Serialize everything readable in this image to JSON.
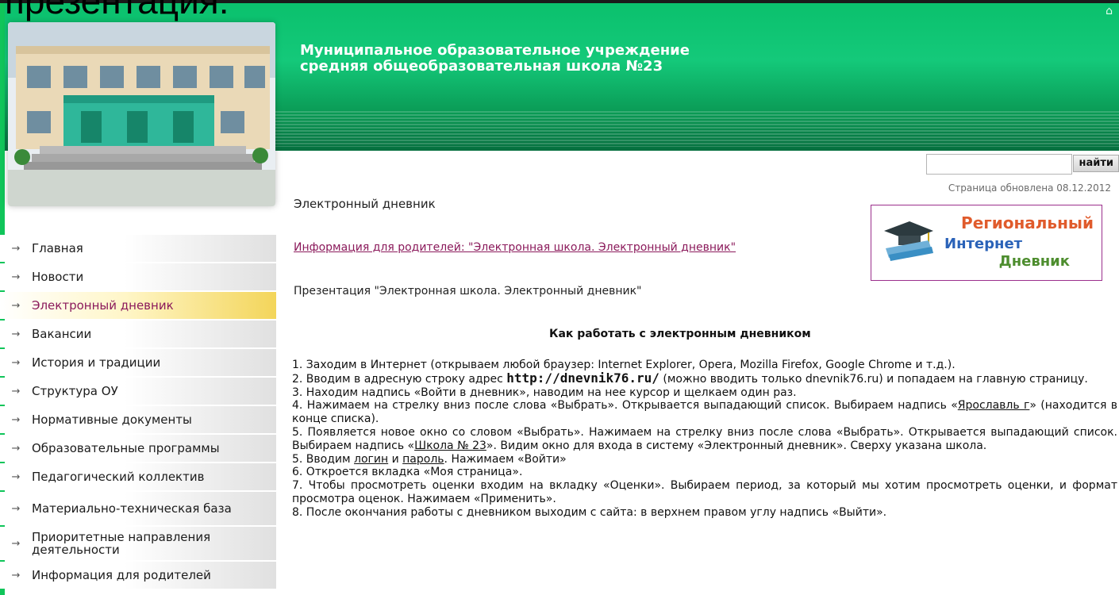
{
  "header": {
    "cut_text": "презентация:",
    "title_line1": "Муниципальное образовательное учреждение",
    "title_line2": "средняя общеобразовательная школа №23"
  },
  "search": {
    "button_label": "найти",
    "value": ""
  },
  "updated": "Страница обновлена 08.12.2012",
  "page_heading": "Электронный дневник",
  "info_link": "Информация для родителей: \"Электронная школа. Электронный дневник\"",
  "presentation": "Презентация \"Электронная школа. Электронный дневник\"",
  "how_title": "Как работать с электронным дневником",
  "banner": {
    "line1": "Региональный",
    "line2": "Интернет",
    "line3": "Дневник"
  },
  "nav": [
    "Главная",
    "Новости",
    "Электронный дневник",
    "Вакансии",
    "История и традиции",
    "Структура ОУ",
    "Нормативные документы",
    "Образовательные программы",
    "Педагогический коллектив",
    "Материально-техническая база",
    "Приоритетные направления деятельности",
    "Информация для родителей"
  ],
  "instructions": {
    "s1": "1. Заходим в Интернет (открываем любой браузер: Internet Explorer, Opera, Mozilla Firefox, Google Chrome и т.д.).",
    "s2a": "2. Вводим в адресную строку адрес ",
    "s2b": "http://dnevnik76.ru/",
    "s2c": " (можно вводить только dnevnik76.ru) и попадаем на главную страницу.",
    "s3": "3. Находим надпись «Войти в дневник», наводим на нее курсор и щелкаем один раз.",
    "s4a": "4. Нажимаем на стрелку вниз после слова «Выбрать». Открывается выпадающий список. Выбираем надпись «",
    "s4b": "Ярославль г",
    "s4c": "» (находится в конце списка).",
    "s5a": "5. Появляется новое окно со словом «Выбрать». Нажимаем на стрелку вниз после слова «Выбрать». Открывается выпадающий список. Выбираем надпись «",
    "s5b": "Школа № 23",
    "s5c": "». Видим окно для входа в систему «Электронный дневник». Сверху указана школа.",
    "s6a": "5. Вводим ",
    "s6b": "логин",
    "s6c": " и ",
    "s6d": "пароль",
    "s6e": ". Нажимаем «Войти»",
    "s7": "6. Откроется вкладка «Моя страница».",
    "s8": "7. Чтобы просмотреть оценки входим на вкладку «Оценки». Выбираем период, за который мы хотим просмотреть оценки, и формат просмотра оценок. Нажимаем «Применить».",
    "s9": "8. После окончания работы с дневником выходим с сайта: в верхнем правом углу надпись «Выйти»."
  }
}
